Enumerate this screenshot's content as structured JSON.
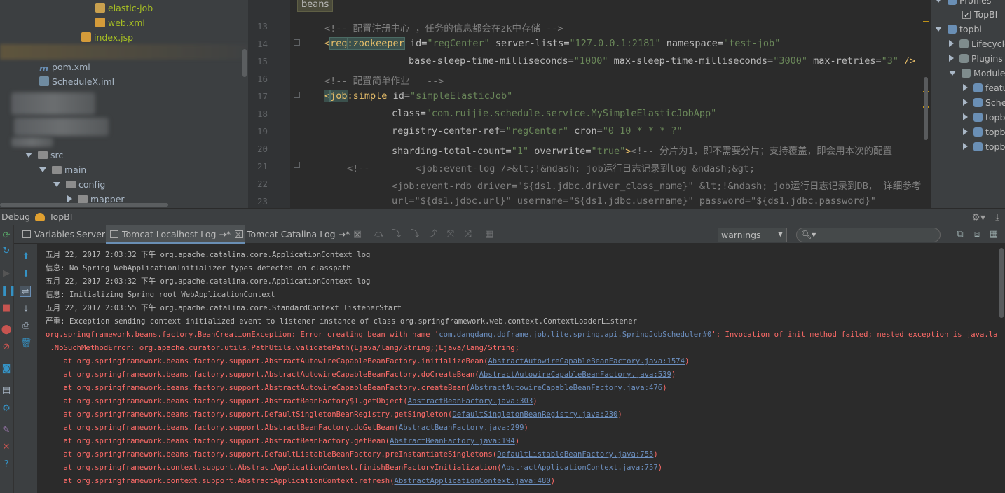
{
  "project_tree": {
    "items": [
      {
        "label": "elastic-job",
        "kind": "folder-orange"
      },
      {
        "label": "web.xml",
        "kind": "xml"
      },
      {
        "label": "index.jsp",
        "kind": "jsp"
      },
      {
        "label": "pom.xml",
        "kind": "maven"
      },
      {
        "label": "ScheduleX.iml",
        "kind": "iml"
      },
      {
        "label": "src",
        "kind": "folder"
      },
      {
        "label": "main",
        "kind": "folder"
      },
      {
        "label": "config",
        "kind": "folder"
      },
      {
        "label": "mapper",
        "kind": "folder"
      }
    ]
  },
  "editor": {
    "breadcrumb": "beans",
    "line_numbers": [
      "13",
      "14",
      "15",
      "16",
      "17",
      "18",
      "19",
      "20",
      "21",
      "22",
      "23"
    ],
    "lines": {
      "l13": "<!-- 配置注册中心 ，任务的信息都会在zk中存储 -->",
      "l14_open": "<",
      "l14_ns": "reg",
      "l14_tag": ":zookeeper",
      "l14_a1": " id=",
      "l14_v1": "\"regCenter\"",
      "l14_a2": " server-lists=",
      "l14_v2": "\"127.0.0.1:2181\"",
      "l14_a3": " namespace=",
      "l14_v3": "\"test-job\"",
      "l15_a1": "base-sleep-time-milliseconds=",
      "l15_v1": "\"1000\"",
      "l15_a2": " max-sleep-time-milliseconds=",
      "l15_v2": "\"3000\"",
      "l15_a3": " max-retries=",
      "l15_v3": "\"3\"",
      "l15_close": " />",
      "l16": "<!-- 配置简单作业   -->",
      "l17_open": "<",
      "l17_ns": "job",
      "l17_tag": ":simple",
      "l17_a1": " id=",
      "l17_v1": "\"simpleElasticJob\"",
      "l18_a1": "class=",
      "l18_v1": "\"com.ruijie.schedule.service.MySimpleElasticJobApp\"",
      "l19_a1": "registry-center-ref=",
      "l19_v1": "\"regCenter\"",
      "l19_a2": " cron=",
      "l19_v2": "\"0 10 * * * ?\"",
      "l20_a1": "sharding-total-count=",
      "l20_v1": "\"1\"",
      "l20_a2": " overwrite=",
      "l20_v2": "\"true\"",
      "l20_close": ">",
      "l20_c": "<!-- 分片为1，即不需要分片；支持覆盖，即会用本次的配置",
      "l21": "<!--        <job:event-log />&lt;!&ndash; job运行日志记录到log &ndash;&gt;",
      "l22": "<job:event-rdb driver=\"${ds1.jdbc.driver_class_name}\" &lt;!&ndash; job运行日志记录到DB， 详细参考",
      "l23": "url=\"${ds1.jdbc.url}\" username=\"${ds1.jdbc.username}\" password=\"${ds1.jdbc.password}\""
    }
  },
  "maven": {
    "items": [
      {
        "label": "Profiles"
      },
      {
        "label": "TopBI"
      },
      {
        "label": "topbi"
      },
      {
        "label": "Lifecycle"
      },
      {
        "label": "Plugins"
      },
      {
        "label": "Modules"
      },
      {
        "label": "featu"
      },
      {
        "label": "Sche"
      },
      {
        "label": "topb"
      },
      {
        "label": "topb"
      },
      {
        "label": "topb"
      }
    ]
  },
  "debug": {
    "title_prefix": "Debug",
    "config_name": "TopBI",
    "tabs": [
      {
        "label": "Variables"
      },
      {
        "label": "Server"
      },
      {
        "label": "Tomcat Localhost Log",
        "suffix": "→*"
      },
      {
        "label": "Tomcat Catalina Log",
        "suffix": "→*"
      }
    ],
    "filter_value": "warnings",
    "search_placeholder": ""
  },
  "log_lines": [
    {
      "type": "info",
      "text": "五月 22, 2017 2:03:32 下午 org.apache.catalina.core.ApplicationContext log"
    },
    {
      "type": "info",
      "text": "信息: No Spring WebApplicationInitializer types detected on classpath"
    },
    {
      "type": "info",
      "text": "五月 22, 2017 2:03:32 下午 org.apache.catalina.core.ApplicationContext log"
    },
    {
      "type": "info",
      "text": "信息: Initializing Spring root WebApplicationContext"
    },
    {
      "type": "info",
      "text": "五月 22, 2017 2:03:55 下午 org.apache.catalina.core.StandardContext listenerStart"
    },
    {
      "type": "info",
      "text": "严重: Exception sending context initialized event to listener instance of class org.springframework.web.context.ContextLoaderListener"
    },
    {
      "type": "err",
      "pre": "org.springframework.beans.factory.BeanCreationException: Error creating bean with name '",
      "link": "com.dangdang.ddframe.job.lite.spring.api.SpringJobScheduler#0",
      "post": "': Invocation of init method failed; nested exception is java.lang"
    },
    {
      "type": "err",
      "pre": " .NoSuchMethodError: org.apache.curator.utils.PathUtils.validatePath(Ljava/lang/String;)Ljava/lang/String;",
      "link": "",
      "post": ""
    },
    {
      "type": "err",
      "pre": "    at org.springframework.beans.factory.support.AbstractAutowireCapableBeanFactory.initializeBean(",
      "link": "AbstractAutowireCapableBeanFactory.java:1574",
      "post": ")"
    },
    {
      "type": "err",
      "pre": "    at org.springframework.beans.factory.support.AbstractAutowireCapableBeanFactory.doCreateBean(",
      "link": "AbstractAutowireCapableBeanFactory.java:539",
      "post": ")"
    },
    {
      "type": "err",
      "pre": "    at org.springframework.beans.factory.support.AbstractAutowireCapableBeanFactory.createBean(",
      "link": "AbstractAutowireCapableBeanFactory.java:476",
      "post": ")"
    },
    {
      "type": "err",
      "pre": "    at org.springframework.beans.factory.support.AbstractBeanFactory$1.getObject(",
      "link": "AbstractBeanFactory.java:303",
      "post": ")"
    },
    {
      "type": "err",
      "pre": "    at org.springframework.beans.factory.support.DefaultSingletonBeanRegistry.getSingleton(",
      "link": "DefaultSingletonBeanRegistry.java:230",
      "post": ")"
    },
    {
      "type": "err",
      "pre": "    at org.springframework.beans.factory.support.AbstractBeanFactory.doGetBean(",
      "link": "AbstractBeanFactory.java:299",
      "post": ")"
    },
    {
      "type": "err",
      "pre": "    at org.springframework.beans.factory.support.AbstractBeanFactory.getBean(",
      "link": "AbstractBeanFactory.java:194",
      "post": ")"
    },
    {
      "type": "err",
      "pre": "    at org.springframework.beans.factory.support.DefaultListableBeanFactory.preInstantiateSingletons(",
      "link": "DefaultListableBeanFactory.java:755",
      "post": ")"
    },
    {
      "type": "err",
      "pre": "    at org.springframework.context.support.AbstractApplicationContext.finishBeanFactoryInitialization(",
      "link": "AbstractApplicationContext.java:757",
      "post": ")"
    },
    {
      "type": "err",
      "pre": "    at org.springframework.context.support.AbstractApplicationContext.refresh(",
      "link": "AbstractApplicationContext.java:480",
      "post": ")"
    }
  ],
  "colors": {
    "background": "#2b2b2b",
    "panel": "#3c3f41",
    "error_text": "#ff6b68",
    "link": "#6c8fbf",
    "xml_tag": "#e8bf6a",
    "xml_value": "#6a8759",
    "comment": "#808080"
  }
}
